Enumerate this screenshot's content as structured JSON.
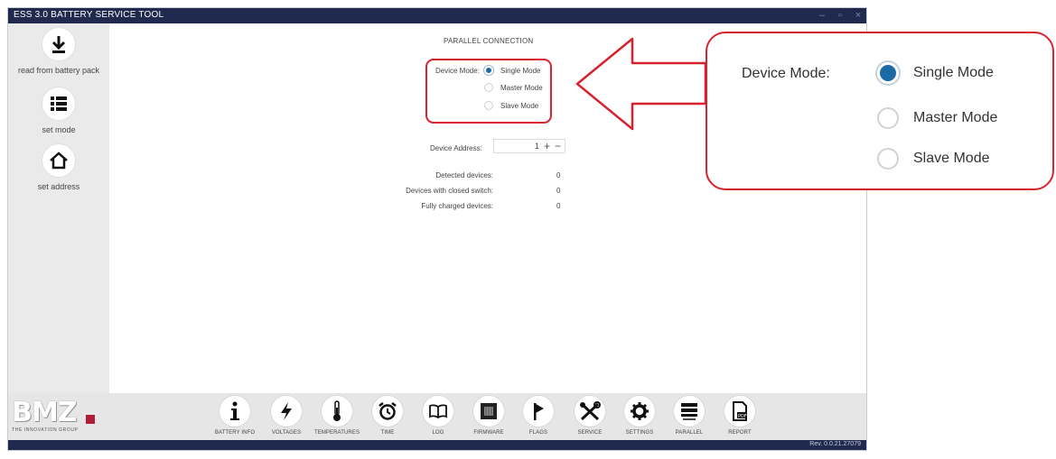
{
  "window": {
    "title": "ESS 3.0 BATTERY SERVICE TOOL",
    "controls": [
      "–",
      "▫",
      "×"
    ]
  },
  "sidebar": {
    "items": [
      {
        "label": "read from battery pack",
        "icon": "download-icon"
      },
      {
        "label": "set mode",
        "icon": "list-icon"
      },
      {
        "label": "set address",
        "icon": "home-icon"
      }
    ]
  },
  "main": {
    "section_title": "PARALLEL CONNECTION",
    "device_mode": {
      "label": "Device Mode:",
      "options": [
        "Single Mode",
        "Master Mode",
        "Slave Mode"
      ],
      "selected": "Single Mode"
    },
    "device_address": {
      "label": "Device Address:",
      "value": "1",
      "plus": "+",
      "minus": "−"
    },
    "stats": [
      {
        "label": "Detected devices:",
        "value": "0"
      },
      {
        "label": "Devices with closed switch:",
        "value": "0"
      },
      {
        "label": "Fully charged devices:",
        "value": "0"
      }
    ]
  },
  "logo": {
    "text": "BMZ",
    "tagline": "THE INNOVATION GROUP",
    "accent": "#b01d35"
  },
  "nav": [
    {
      "label": "BATTERY INFO",
      "icon": "info-icon"
    },
    {
      "label": "VOLTAGES",
      "icon": "lightning-icon"
    },
    {
      "label": "TEMPERATURES",
      "icon": "thermometer-icon"
    },
    {
      "label": "TIME",
      "icon": "alarm-clock-icon"
    },
    {
      "label": "LOG",
      "icon": "book-icon"
    },
    {
      "label": "FIRMWARE",
      "icon": "chip-icon"
    },
    {
      "label": "FLAGS",
      "icon": "flag-icon"
    },
    {
      "label": "SERVICE",
      "icon": "tools-icon"
    },
    {
      "label": "SETTINGS",
      "icon": "gear-icon"
    },
    {
      "label": "PARALLEL",
      "icon": "server-icon"
    },
    {
      "label": "REPORT",
      "icon": "pdf-icon"
    }
  ],
  "status": {
    "revision": "Rev. 0.0.21.27079"
  },
  "callout": {
    "label": "Device Mode:",
    "options": [
      "Single Mode",
      "Master Mode",
      "Slave Mode"
    ],
    "selected": "Single Mode"
  },
  "colors": {
    "titlebar": "#1f2a4e",
    "highlight": "#d8232f",
    "radio_selected": "#1b6aa5",
    "sidebar": "#eaeaea"
  }
}
